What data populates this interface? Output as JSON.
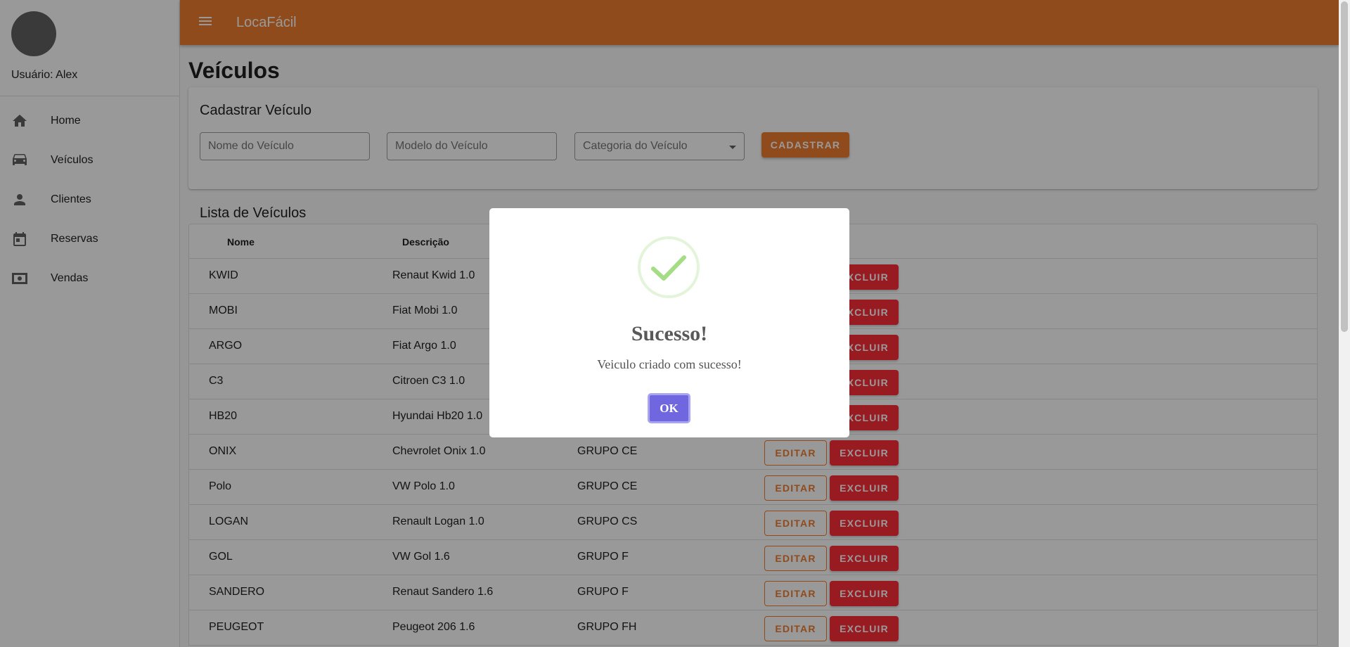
{
  "sidebar": {
    "username": "Usuário: Alex",
    "items": [
      {
        "label": "Home",
        "icon": "home-icon"
      },
      {
        "label": "Veículos",
        "icon": "car-icon"
      },
      {
        "label": "Clientes",
        "icon": "person-icon"
      },
      {
        "label": "Reservas",
        "icon": "calendar-icon"
      },
      {
        "label": "Vendas",
        "icon": "money-icon"
      }
    ]
  },
  "appbar": {
    "title": "LocaFácil",
    "menu_icon": "menu-icon"
  },
  "page": {
    "title": "Veículos"
  },
  "form": {
    "title": "Cadastrar Veículo",
    "name_placeholder": "Nome do Veículo",
    "model_placeholder": "Modelo do Veículo",
    "category_placeholder": "Categoria do Veículo",
    "submit_label": "CADASTRAR"
  },
  "list": {
    "title": "Lista de Veículos",
    "columns": [
      "Nome",
      "Descrição"
    ],
    "edit_label": "EDITAR",
    "delete_label": "EXCLUIR",
    "rows": [
      {
        "name": "KWID",
        "description": "Renaut Kwid 1.0",
        "group": ""
      },
      {
        "name": "MOBI",
        "description": "Fiat Mobi 1.0",
        "group": ""
      },
      {
        "name": "ARGO",
        "description": "Fiat Argo 1.0",
        "group": ""
      },
      {
        "name": "C3",
        "description": "Citroen C3 1.0",
        "group": ""
      },
      {
        "name": "HB20",
        "description": "Hyundai Hb20 1.0",
        "group": ""
      },
      {
        "name": "ONIX",
        "description": "Chevrolet Onix 1.0",
        "group": "GRUPO CE"
      },
      {
        "name": "Polo",
        "description": "VW Polo 1.0",
        "group": "GRUPO CE"
      },
      {
        "name": "LOGAN",
        "description": "Renault Logan 1.0",
        "group": "GRUPO CS"
      },
      {
        "name": "GOL",
        "description": "VW Gol 1.6",
        "group": "GRUPO F"
      },
      {
        "name": "SANDERO",
        "description": "Renaut Sandero 1.6",
        "group": "GRUPO F"
      },
      {
        "name": "PEUGEOT",
        "description": "Peugeot 206 1.6",
        "group": "GRUPO FH"
      }
    ]
  },
  "modal": {
    "icon": "checkmark-icon",
    "title": "Sucesso!",
    "message": "Veiculo criado com sucesso!",
    "ok_label": "OK"
  },
  "colors": {
    "primary": "#ee7d30",
    "danger": "#ff2d3a",
    "success": "#a5dc86",
    "confirm": "#7066e0"
  }
}
